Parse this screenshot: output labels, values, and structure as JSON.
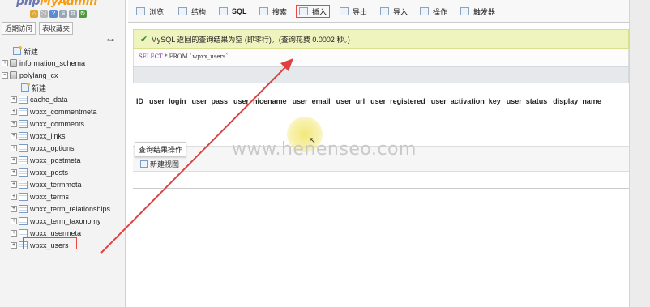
{
  "logo": {
    "text_prefix": "php",
    "text_suffix": "MyAdmin"
  },
  "sidebar": {
    "tabs": [
      "近期访问",
      "表收藏夹"
    ],
    "tree": [
      {
        "label": "新建",
        "kind": "new"
      },
      {
        "label": "information_schema",
        "kind": "db"
      },
      {
        "label": "polylang_cx",
        "kind": "db"
      },
      {
        "label": "新建",
        "kind": "new-table"
      },
      {
        "label": "cache_data",
        "kind": "table"
      },
      {
        "label": "wpxx_commentmeta",
        "kind": "table"
      },
      {
        "label": "wpxx_comments",
        "kind": "table"
      },
      {
        "label": "wpxx_links",
        "kind": "table"
      },
      {
        "label": "wpxx_options",
        "kind": "table"
      },
      {
        "label": "wpxx_postmeta",
        "kind": "table"
      },
      {
        "label": "wpxx_posts",
        "kind": "table"
      },
      {
        "label": "wpxx_termmeta",
        "kind": "table"
      },
      {
        "label": "wpxx_terms",
        "kind": "table"
      },
      {
        "label": "wpxx_term_relationships",
        "kind": "table"
      },
      {
        "label": "wpxx_term_taxonomy",
        "kind": "table"
      },
      {
        "label": "wpxx_usermeta",
        "kind": "table"
      },
      {
        "label": "wpxx_users",
        "kind": "table",
        "selected": true
      }
    ]
  },
  "topnav": {
    "items": [
      "浏览",
      "结构",
      "SQL",
      "搜索",
      "插入",
      "导出",
      "导入",
      "操作",
      "触发器"
    ]
  },
  "message": {
    "text": "MySQL 返回的查询结果为空 (即零行)。(查询花费 0.0002 秒。)"
  },
  "sql": {
    "keyword_select": "SELECT",
    "rest": "* FROM `wpxx_users`"
  },
  "result": {
    "columns": [
      "ID",
      "user_login",
      "user_pass",
      "user_nicename",
      "user_email",
      "user_url",
      "user_registered",
      "user_activation_key",
      "user_status",
      "display_name"
    ],
    "ops_label": "查询结果操作",
    "create_view_label": "新建视图"
  },
  "watermark": "www.henenseo.com",
  "colors": {
    "success_bg": "#eff4bf",
    "highlight": "#e44444",
    "arrow": "#e04040"
  }
}
